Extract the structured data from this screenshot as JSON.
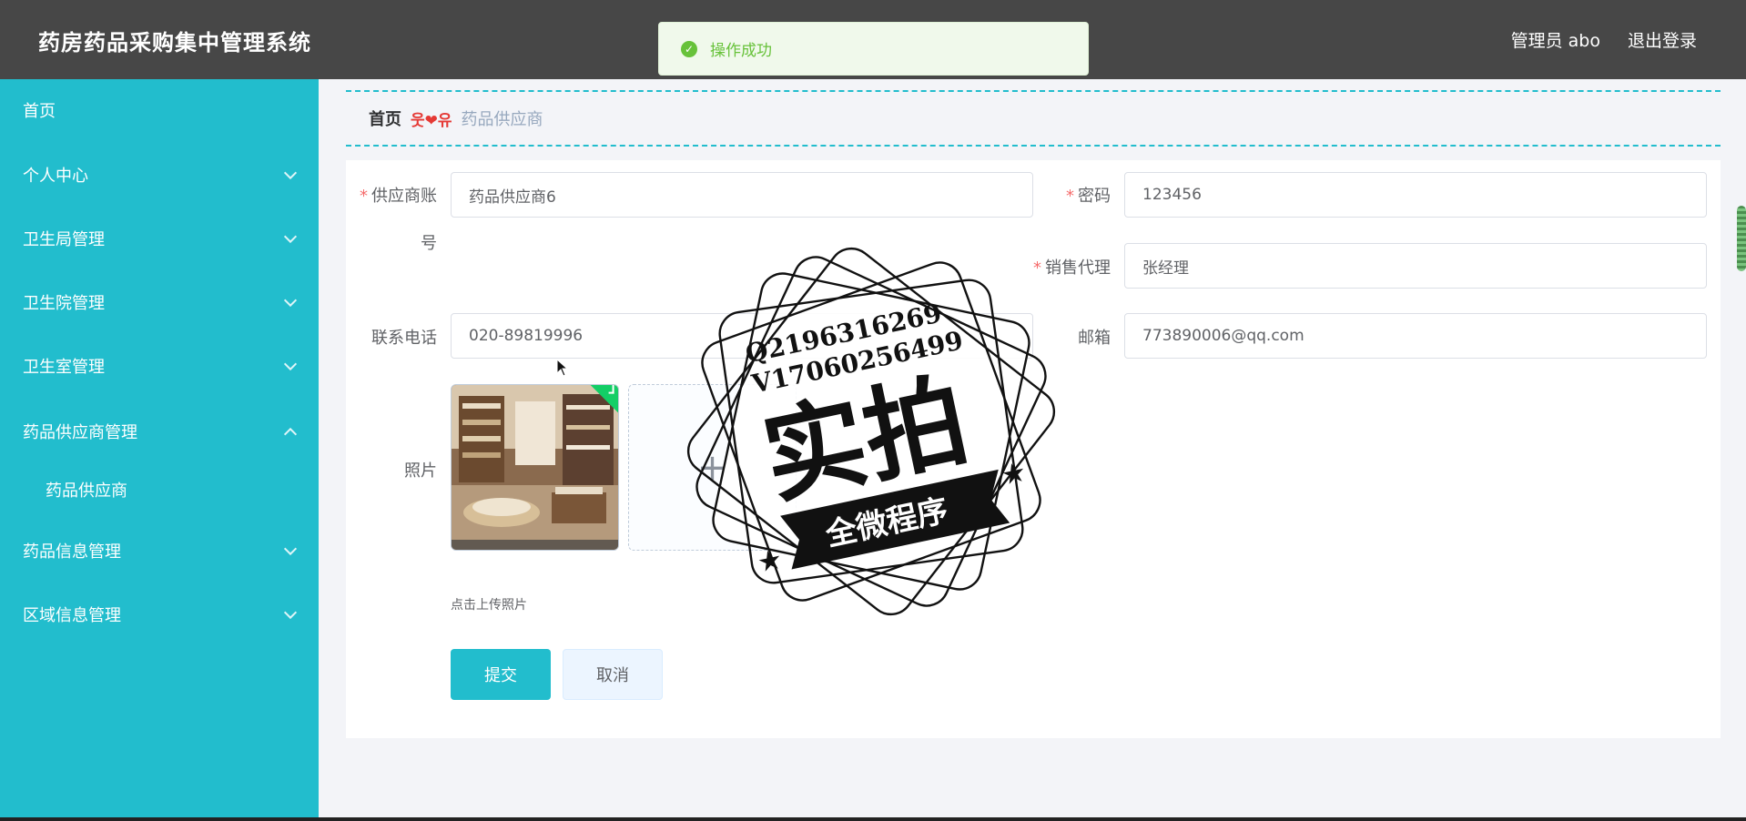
{
  "header": {
    "app_title": "药房药品采购集中管理系统",
    "user_label": "管理员 abo",
    "logout_label": "退出登录"
  },
  "toast": {
    "message": "操作成功",
    "type": "success"
  },
  "sidebar": {
    "items": [
      {
        "label": "首页",
        "expandable": false
      },
      {
        "label": "个人中心",
        "expandable": true,
        "expanded": false
      },
      {
        "label": "卫生局管理",
        "expandable": true,
        "expanded": false
      },
      {
        "label": "卫生院管理",
        "expandable": true,
        "expanded": false
      },
      {
        "label": "卫生室管理",
        "expandable": true,
        "expanded": false
      },
      {
        "label": "药品供应商管理",
        "expandable": true,
        "expanded": true,
        "children": [
          {
            "label": "药品供应商"
          }
        ]
      },
      {
        "label": "药品信息管理",
        "expandable": true,
        "expanded": false
      },
      {
        "label": "区域信息管理",
        "expandable": true,
        "expanded": false
      }
    ]
  },
  "breadcrumb": {
    "home": "首页",
    "separator": "웃❤유",
    "current": "药品供应商"
  },
  "form": {
    "supplier_account": {
      "label_line1": "供应商账",
      "label_line2": "号",
      "value": "药品供应商6",
      "required": true
    },
    "password": {
      "label": "密码",
      "value": "123456",
      "required": true
    },
    "sales_agent": {
      "label": "销售代理",
      "value": "张经理",
      "required": true
    },
    "phone": {
      "label": "联系电话",
      "value": "020-89819996"
    },
    "email": {
      "label": "邮箱",
      "value": "773890006@qq.com"
    },
    "photo": {
      "label": "照片",
      "upload_tip": "点击上传照片",
      "uploaded": true
    },
    "submit_label": "提交",
    "cancel_label": "取消"
  },
  "watermark": {
    "line1": "Q2196316269",
    "line2": "V17060256499",
    "main_text": "实拍",
    "banner_text": "全微程序"
  },
  "colors": {
    "header_bg": "#474747",
    "sidebar_bg": "#22bdcd",
    "accent": "#22bdcd",
    "success": "#67c23a",
    "required": "#f56c6c"
  }
}
